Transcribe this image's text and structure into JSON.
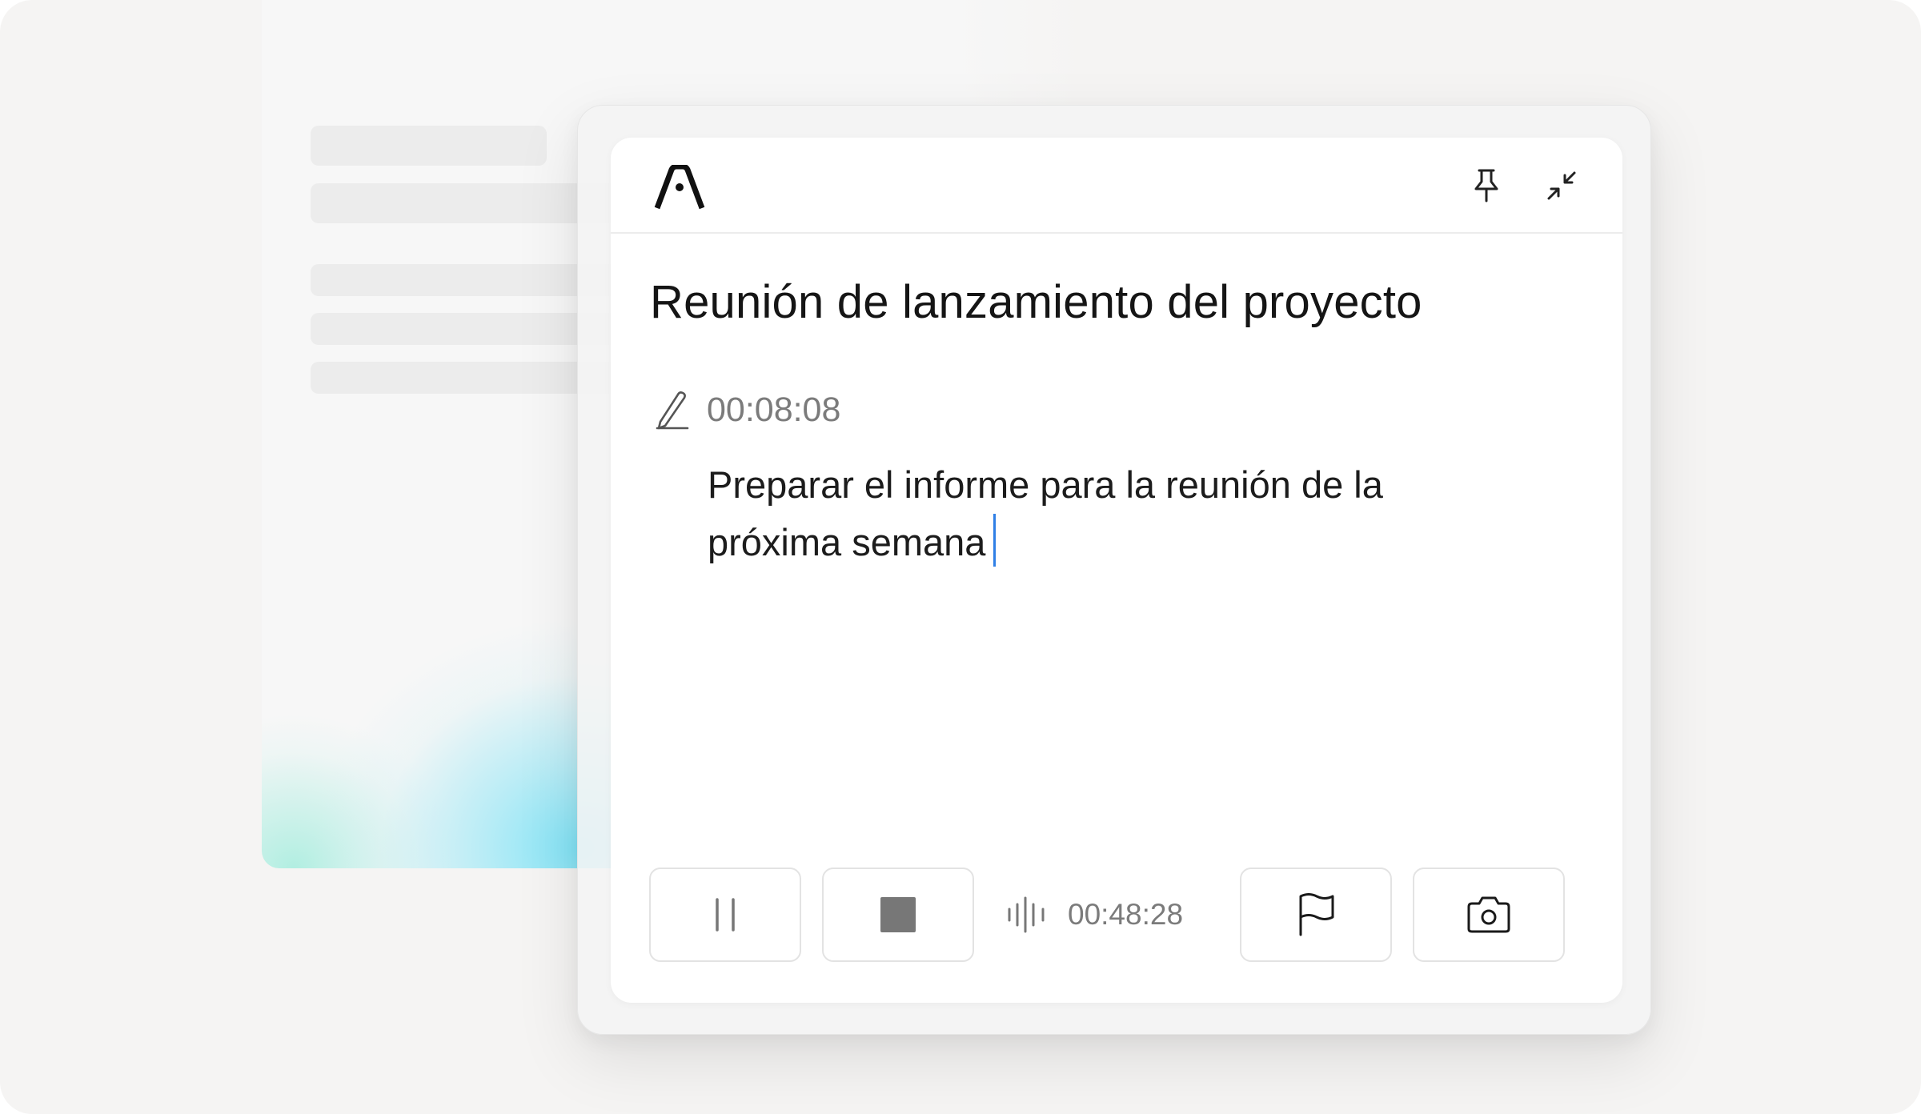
{
  "note": {
    "title": "Reunión de lanzamiento del proyecto",
    "timestamp": "00:08:08",
    "text": "Preparar el informe para la reunión de la próxima semana"
  },
  "recording": {
    "elapsed": "00:48:28"
  },
  "icons": {
    "logo": "app-logo",
    "pin": "pin-icon",
    "collapse": "collapse-icon",
    "pen": "pen-icon",
    "pause": "pause-icon",
    "stop": "stop-icon",
    "waveform": "waveform-icon",
    "flag": "flag-icon",
    "camera": "camera-icon"
  },
  "colors": {
    "caret": "#2f7fe6",
    "accent_gradient": "#7ae2f6"
  }
}
